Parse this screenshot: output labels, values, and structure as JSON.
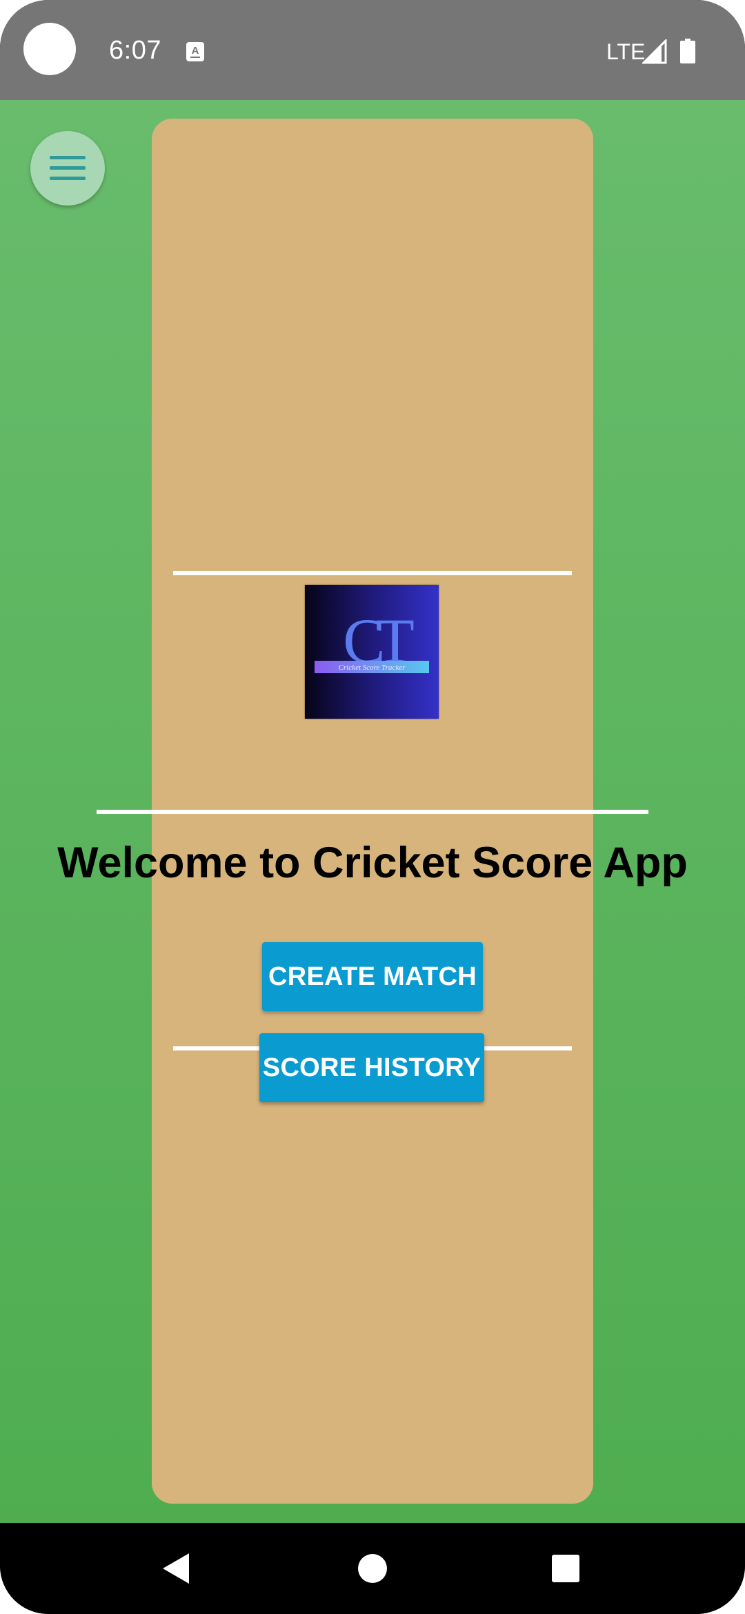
{
  "status_bar": {
    "time": "6:07",
    "network": "LTE",
    "icons": [
      "notification-a-icon",
      "signal-icon",
      "battery-icon"
    ]
  },
  "app": {
    "menu_icon": "hamburger-menu-icon",
    "logo": {
      "letters": "CT",
      "subtitle": "Cricket Score Tracker"
    },
    "welcome_title": "Welcome to Cricket Score App",
    "buttons": {
      "create_match": "CREATE MATCH",
      "score_history": "SCORE HISTORY"
    },
    "colors": {
      "field_green": "#5cb45f",
      "pitch": "#d8b47d",
      "button_blue": "#0a9bd1",
      "fab": "#a7d8b3"
    }
  },
  "nav_bar": {
    "icons": [
      "back-icon",
      "home-icon",
      "recents-icon"
    ]
  }
}
